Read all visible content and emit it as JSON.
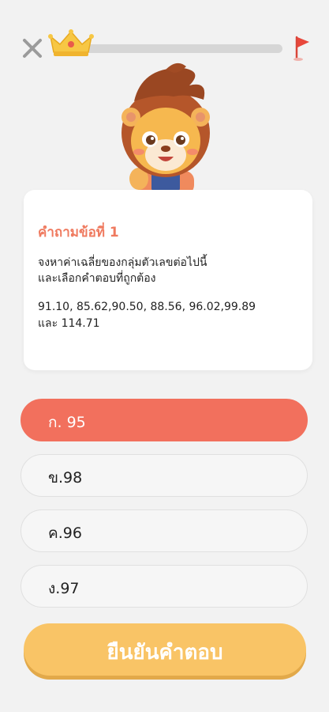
{
  "header": {
    "close_icon": "close-icon",
    "crown_icon": "crown-icon",
    "flag_icon": "flag-icon",
    "progress": 0
  },
  "question": {
    "title": "คำถามข้อที่ 1",
    "body_line1": "จงหาค่าเฉลี่ยของกลุ่มตัวเลขต่อไปนี้",
    "body_line2": "และเลือกคำตอบที่ถูกต้อง",
    "numbers_line1": "91.10, 85.62,90.50, 88.56, 96.02,99.89",
    "numbers_line2": "และ 114.71"
  },
  "options": [
    {
      "label": "ก. 95",
      "selected": true
    },
    {
      "label": "ข.98",
      "selected": false
    },
    {
      "label": "ค.96",
      "selected": false
    },
    {
      "label": "ง.97",
      "selected": false
    }
  ],
  "confirm": {
    "label": "ยืนยันคำตอบ"
  },
  "colors": {
    "accent": "#f2705d",
    "title": "#ef7a5f",
    "confirm": "#f9c466"
  }
}
